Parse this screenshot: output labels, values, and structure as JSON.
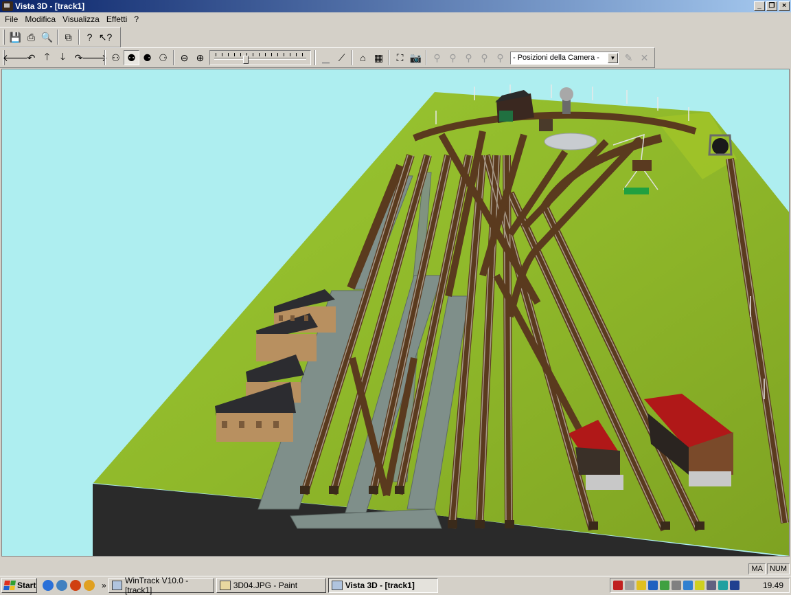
{
  "window": {
    "title": "Vista 3D - [track1]"
  },
  "menu": [
    "File",
    "Modifica",
    "Visualizza",
    "Effetti",
    "?"
  ],
  "toolbar2": {
    "camera_select": "- Posizioni della Camera -"
  },
  "statusbar": {
    "ma": "MA",
    "num": "NUM"
  },
  "taskbar": {
    "start": "Start",
    "chevron": "»",
    "buttons": [
      "WinTrack  V10.0 - [track1]",
      "3D04.JPG - Paint",
      "Vista 3D - [track1]"
    ],
    "clock": "19.49"
  },
  "colors": {
    "sky": "#aeeef0",
    "grass": "#8fb82a",
    "track": "#6b4a2a",
    "platform": "#7f8f8a",
    "roof_red": "#b01818",
    "roof_dark": "#2c2c30"
  }
}
